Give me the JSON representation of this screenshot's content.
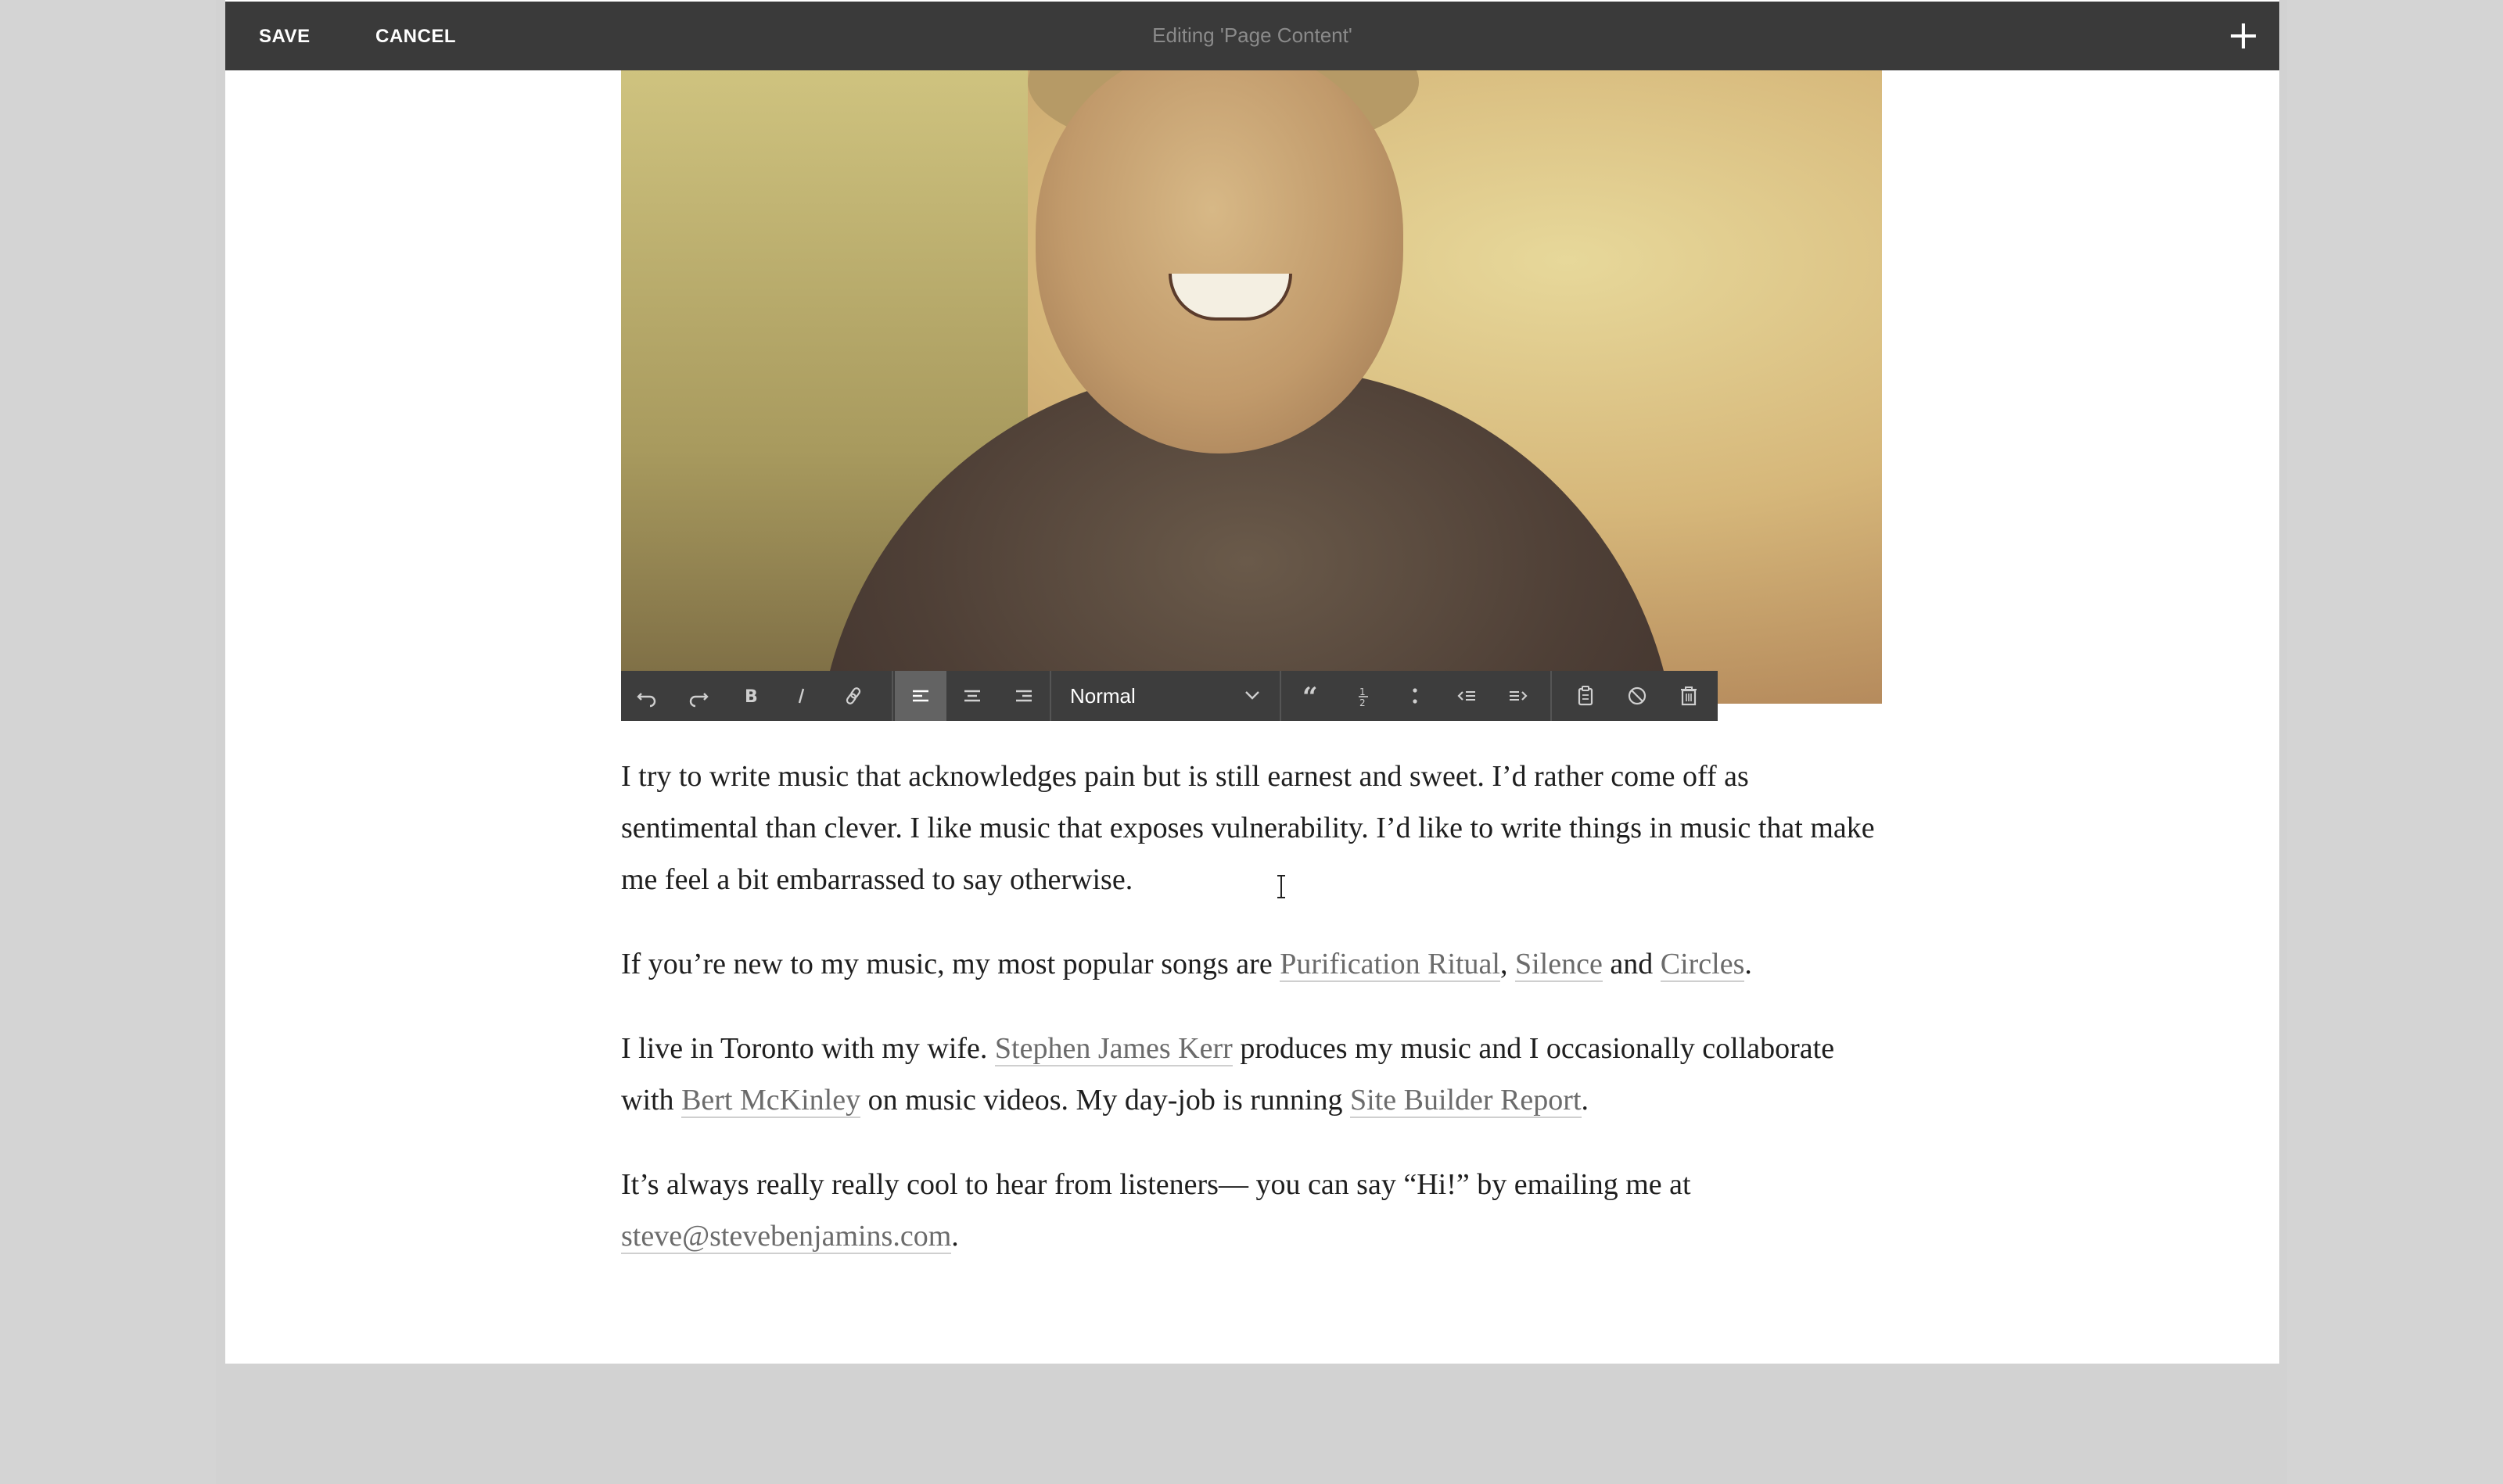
{
  "topbar": {
    "save_label": "SAVE",
    "cancel_label": "CANCEL",
    "title": "Editing 'Page Content'",
    "add_icon": "plus-icon"
  },
  "toolbar": {
    "buttons": [
      {
        "name": "undo-icon"
      },
      {
        "name": "redo-icon"
      },
      {
        "name": "bold-icon"
      },
      {
        "name": "italic-icon"
      },
      {
        "name": "link-icon"
      },
      {
        "name": "align-left-icon",
        "active": true
      },
      {
        "name": "align-center-icon"
      },
      {
        "name": "align-right-icon"
      },
      {
        "name": "blockquote-icon"
      },
      {
        "name": "numbered-list-icon"
      },
      {
        "name": "bullet-list-icon"
      },
      {
        "name": "outdent-icon"
      },
      {
        "name": "indent-icon"
      },
      {
        "name": "paste-icon"
      },
      {
        "name": "clear-format-icon"
      },
      {
        "name": "delete-icon"
      }
    ],
    "format_value": "Normal"
  },
  "content": {
    "p1": "I try to write music that acknowledges pain but is still earnest and sweet. I’d rather come off as sentimental than clever. I like music that exposes vulnerability. I’d like to write things in music that make me feel a bit embarrassed to say otherwise.",
    "p2_before": "If you’re new to my music, my most popular songs are ",
    "p2_link1": "Purification Ritual",
    "p2_sep1": ", ",
    "p2_link2": "Silence",
    "p2_sep2": " and ",
    "p2_link3": "Circles",
    "p2_end": ".",
    "p3_before": "I live in Toronto with my wife. ",
    "p3_link1": "Stephen James Kerr",
    "p3_mid1": " produces my music and I occasionally collaborate with ",
    "p3_link2": "Bert McKinley",
    "p3_mid2": " on music videos. My day-job is running ",
    "p3_link3": "Site Builder Report",
    "p3_end": ".",
    "p4_before": "It’s always really really cool to hear from listeners— you can say “Hi!” by emailing me at ",
    "p4_link": "steve@stevebenjamins.com",
    "p4_end": "."
  }
}
